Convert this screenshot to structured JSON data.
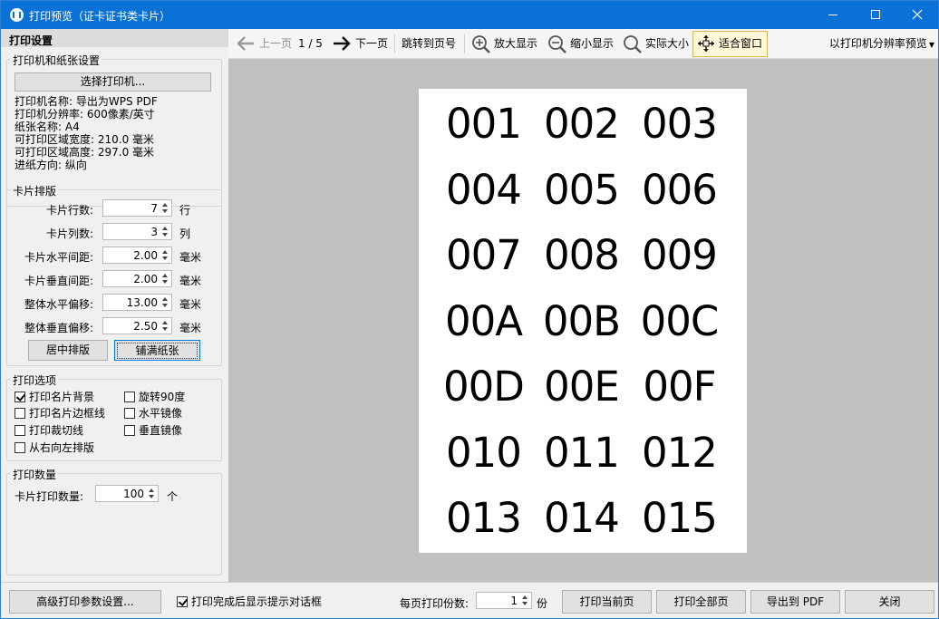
{
  "window": {
    "title": "打印预览（证卡证书类卡片）"
  },
  "left": {
    "header": "打印设置",
    "printer_group": {
      "legend": "打印机和纸张设置",
      "select_button": "选择打印机...",
      "info": [
        "打印机名称: 导出为WPS PDF",
        "打印机分辨率: 600像素/英寸",
        "纸张名称: A4",
        "可打印区域宽度: 210.0 毫米",
        "可打印区域高度: 297.0 毫米",
        "进纸方向: 纵向"
      ]
    },
    "layout_group": {
      "legend": "卡片排版",
      "fields": [
        {
          "label": "卡片行数:",
          "value": "7",
          "unit": "行"
        },
        {
          "label": "卡片列数:",
          "value": "3",
          "unit": "列"
        },
        {
          "label": "卡片水平间距:",
          "value": "2.00",
          "unit": "毫米"
        },
        {
          "label": "卡片垂直间距:",
          "value": "2.00",
          "unit": "毫米"
        },
        {
          "label": "整体水平偏移:",
          "value": "13.00",
          "unit": "毫米"
        },
        {
          "label": "整体垂直偏移:",
          "value": "2.50",
          "unit": "毫米"
        }
      ],
      "center_button": "居中排版",
      "fill_button": "铺满纸张"
    },
    "options_group": {
      "legend": "打印选项",
      "options": [
        {
          "label": "打印名片背景",
          "checked": true
        },
        {
          "label": "旋转90度",
          "checked": false
        },
        {
          "label": "打印名片边框线",
          "checked": false
        },
        {
          "label": "水平镜像",
          "checked": false
        },
        {
          "label": "打印裁切线",
          "checked": false
        },
        {
          "label": "垂直镜像",
          "checked": false
        },
        {
          "label": "从右向左排版",
          "checked": false
        }
      ]
    },
    "count_group": {
      "legend": "打印数量",
      "label": "卡片打印数量:",
      "value": "100",
      "unit": "个"
    }
  },
  "toolbar": {
    "prev": "上一页",
    "page": "1 / 5",
    "next": "下一页",
    "goto": "跳转到页号",
    "zoom_in": "放大显示",
    "zoom_out": "缩小显示",
    "actual": "实际大小",
    "fit": "适合窗口",
    "mode": "以打印机分辨率预览"
  },
  "preview": {
    "cards": [
      "001",
      "002",
      "003",
      "004",
      "005",
      "006",
      "007",
      "008",
      "009",
      "00A",
      "00B",
      "00C",
      "00D",
      "00E",
      "00F",
      "010",
      "011",
      "012",
      "013",
      "014",
      "015"
    ]
  },
  "bottom": {
    "advanced": "高级打印参数设置...",
    "show_dialog": {
      "label": "打印完成后显示提示对话框",
      "checked": true
    },
    "copies_label": "每页打印份数:",
    "copies_value": "1",
    "copies_unit": "份",
    "print_current": "打印当前页",
    "print_all": "打印全部页",
    "export_pdf": "导出到 PDF",
    "close": "关闭"
  }
}
